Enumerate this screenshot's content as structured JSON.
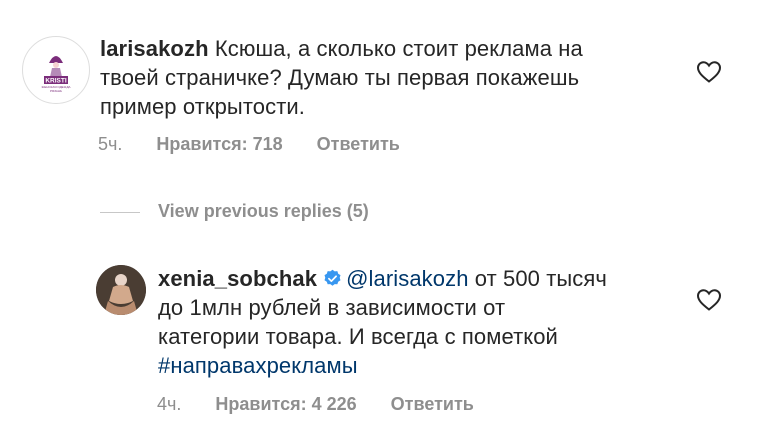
{
  "comments": [
    {
      "username": "larisakozh",
      "text_line1": "Ксюша, а сколько стоит реклама на",
      "text_line2": "твоей страничке? Думаю ты первая покажешь",
      "text_line3": "пример открытости.",
      "time": "5ч.",
      "likes": "Нравится: 718",
      "reply_label": "Ответить",
      "avatar_brand": "KRISTI",
      "avatar_sub1": "ЖЕНСКАЯ ОДЕЖДА",
      "avatar_sub2": "РЯЗАНЬ"
    },
    {
      "username": "xenia_sobchak",
      "mention": "@larisakozh",
      "text_line1_rest": " от 500 тысяч",
      "text_line2": "до 1млн рублей в зависимости от",
      "text_line3": "категории товара. И всегда с пометкой",
      "hashtag": "#направахрекламы",
      "time": "4ч.",
      "likes": "Нравится: 4 226",
      "reply_label": "Ответить"
    }
  ],
  "view_replies_label": "View previous replies (5)",
  "colors": {
    "text": "#262626",
    "secondary": "#8e8e8e",
    "link": "#00376b",
    "verified": "#3897f0",
    "brand_purple": "#7b2d7b"
  }
}
